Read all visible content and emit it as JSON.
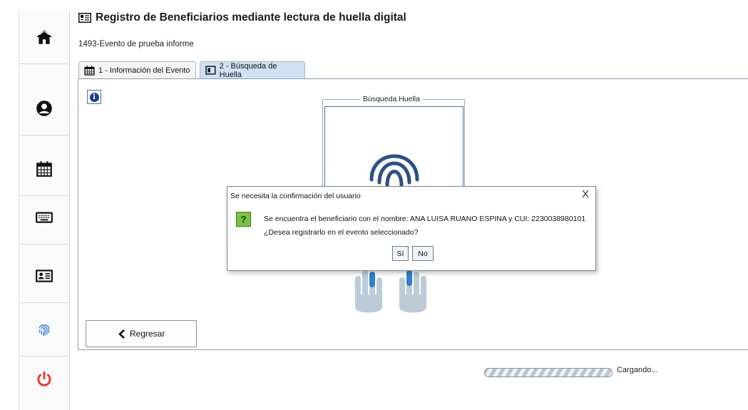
{
  "window": {
    "title": "Registro de Beneficiarios mediante lectura de huella digital",
    "event": "1493-Evento de prueba informe"
  },
  "tabs": [
    {
      "label": "1 - Información del Evento",
      "icon": "calendar-icon",
      "active": false
    },
    {
      "label": "2 - Búsqueda de Huella",
      "icon": "card-icon",
      "active": true
    }
  ],
  "sidebar": {
    "items": [
      {
        "icon": "home-icon"
      },
      {
        "icon": "user-icon"
      },
      {
        "icon": "calendar-icon"
      },
      {
        "icon": "keyboard-icon"
      },
      {
        "icon": "id-card-icon"
      },
      {
        "icon": "fingerprint-icon"
      },
      {
        "icon": "power-icon"
      }
    ]
  },
  "fingerprint_panel": {
    "legend": "Búsqueda Huella"
  },
  "back_button": {
    "label": "Regresar"
  },
  "status": {
    "loading_text": "Cargando..."
  },
  "dialog": {
    "title": "Se necesita la confirmación del usuario",
    "close": "X",
    "icon": "?",
    "message_line1": "Se encuentra el beneficiario con el nombre: ANA LUISA RUANO ESPINA y CUI: 2230038980101",
    "message_line2": "¿Desea registrarlo en el evento seleccionado?",
    "yes_label": "Sí",
    "no_label": "No"
  },
  "colors": {
    "accent": "#1d3f8a",
    "power": "#e8322b",
    "fingerprint_nav": "#5a8fd8",
    "tab_active": "#cfe1f2",
    "question_icon": "#7bc043"
  }
}
